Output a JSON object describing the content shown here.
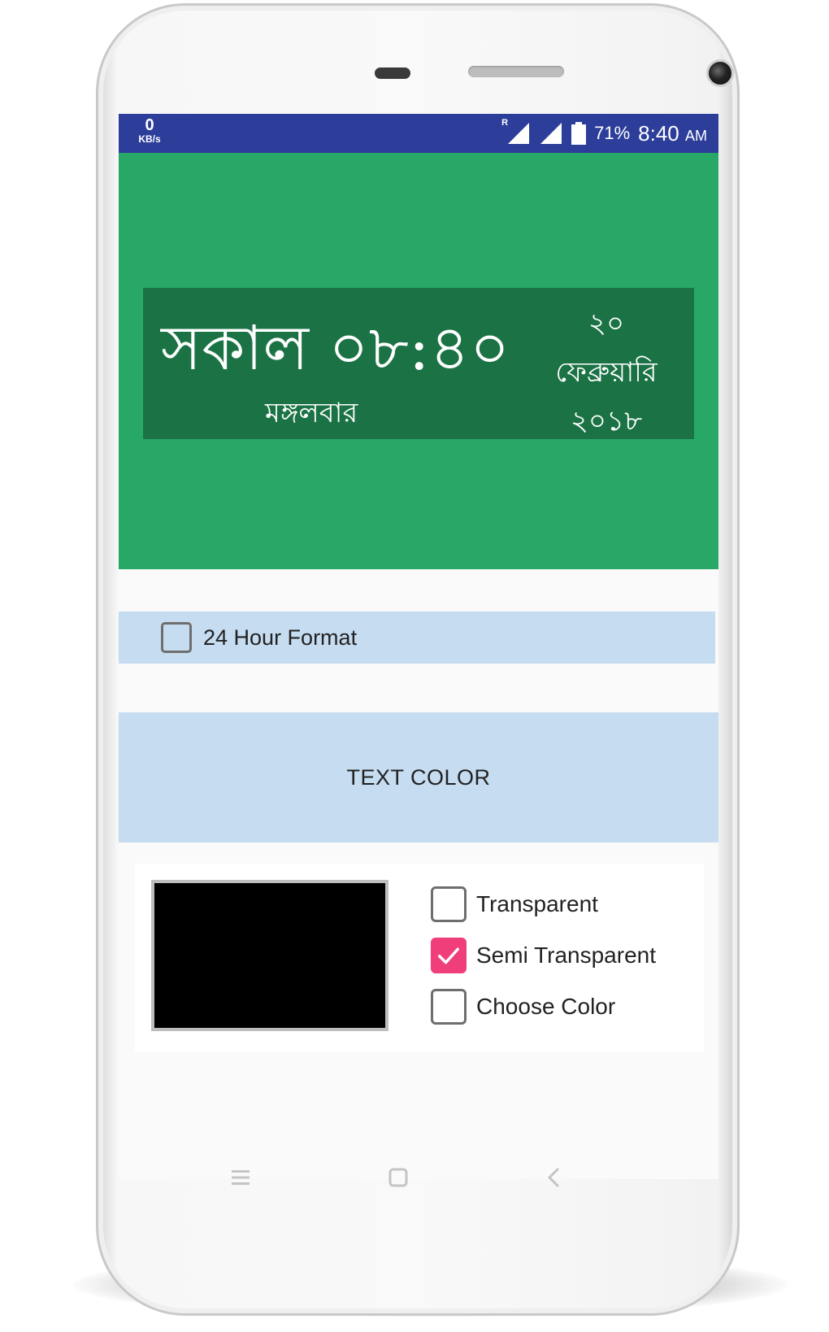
{
  "status_bar": {
    "net_speed_value": "0",
    "net_speed_unit": "KB/s",
    "roaming_mark": "R",
    "battery": "71%",
    "time": "8:40",
    "ampm": "AM",
    "background": "#2c3e9a"
  },
  "clock_widget": {
    "time_text": "সকাল ০৮:৪০",
    "day_text": "মঙ্গলবার",
    "date_day": "২০",
    "date_month": "ফেব্রুয়ারি",
    "date_year": "২০১৮",
    "area_background": "#27a866",
    "widget_background": "#1b7345"
  },
  "settings": {
    "format_checkbox_label": "24 Hour Format",
    "format_checked": false,
    "text_color_button": "TEXT COLOR",
    "swatch_color": "#000000",
    "options": [
      {
        "label": "Transparent",
        "checked": false
      },
      {
        "label": "Semi Transparent",
        "checked": true
      },
      {
        "label": "Choose Color",
        "checked": false
      }
    ],
    "accent_color": "#f03e7a",
    "row_background": "#c6dcf0"
  },
  "nav_bar": {
    "icons": [
      "menu-icon",
      "home-square-icon",
      "back-chevron-icon"
    ]
  }
}
